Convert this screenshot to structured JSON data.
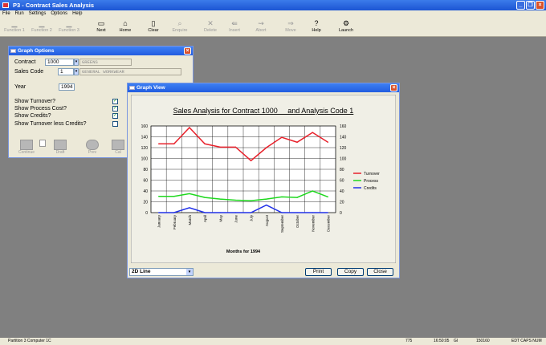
{
  "window": {
    "title": "P3 - Contract Sales Analysis"
  },
  "menu": [
    "File",
    "Run",
    "Settings",
    "Options",
    "Help"
  ],
  "toolbar": [
    {
      "label": "Function 1",
      "icon": "function1-icon",
      "enabled": false
    },
    {
      "label": "Function 2",
      "icon": "function2-icon",
      "enabled": false
    },
    {
      "label": "Function 3",
      "icon": "function3-icon",
      "enabled": false
    },
    {
      "label": "Next",
      "icon": "next-icon",
      "enabled": true
    },
    {
      "label": "Home",
      "icon": "home-icon",
      "enabled": true
    },
    {
      "label": "Clear",
      "icon": "clear-icon",
      "enabled": true
    },
    {
      "label": "Enquire",
      "icon": "enquire-icon",
      "enabled": false
    },
    {
      "label": "Delete",
      "icon": "delete-icon",
      "enabled": false
    },
    {
      "label": "Insert",
      "icon": "insert-icon",
      "enabled": false
    },
    {
      "label": "Abort",
      "icon": "abort-icon",
      "enabled": false
    },
    {
      "label": "Move",
      "icon": "move-icon",
      "enabled": false
    },
    {
      "label": "Help",
      "icon": "help-icon",
      "enabled": true
    },
    {
      "label": "Launch",
      "icon": "launch-icon",
      "enabled": true
    }
  ],
  "graph_options": {
    "title": "Graph Options",
    "contract_label": "Contract",
    "contract_value": "1000",
    "contract_name": "GREENS",
    "sales_code_label": "Sales Code",
    "sales_code_value": "1",
    "sales_code_name": "GENERAL WORKWEAR",
    "year_label": "Year",
    "year_value": "1994",
    "show_turnover": "Show Turnover?",
    "show_process": "Show Process Cost?",
    "show_credits": "Show Credits?",
    "show_turnover_less": "Show Turnover less Credits?",
    "buttons": [
      "Continue",
      "",
      "Draft",
      "Prev",
      "Cal"
    ]
  },
  "graph_view": {
    "title": "Graph View",
    "graph_type": "2D Line",
    "print": "Print",
    "copy": "Copy",
    "close": "Close"
  },
  "chart_data": {
    "type": "line",
    "title": "Sales Analysis for Contract 1000     and Analysis Code 1",
    "xlabel": "Months for 1994",
    "ylabel": "",
    "ylim": [
      0,
      160
    ],
    "yticks": [
      0,
      20,
      40,
      60,
      80,
      100,
      120,
      140,
      160
    ],
    "categories": [
      "January",
      "February",
      "March",
      "April",
      "May",
      "June",
      "July",
      "August",
      "September",
      "October",
      "November",
      "December"
    ],
    "series": [
      {
        "name": "Turnover",
        "color": "#e8212b",
        "values": [
          127,
          127,
          157,
          127,
          121,
          121,
          96,
          120,
          139,
          130,
          148,
          130
        ]
      },
      {
        "name": "Process",
        "color": "#1ed81e",
        "values": [
          30,
          30,
          35,
          28,
          25,
          23,
          22,
          25,
          29,
          28,
          40,
          29
        ]
      },
      {
        "name": "Credits",
        "color": "#2030e8",
        "values": [
          0,
          0,
          9,
          0,
          0,
          0,
          0,
          14,
          0,
          0,
          0,
          0
        ]
      }
    ],
    "grid": true,
    "legend": "right"
  },
  "status": {
    "left": "Partition 3 Computer 1C",
    "num": "775",
    "time": "16:50:05",
    "gi": "GI",
    "code": "150160",
    "flags": "EDT CAPS NUM"
  }
}
